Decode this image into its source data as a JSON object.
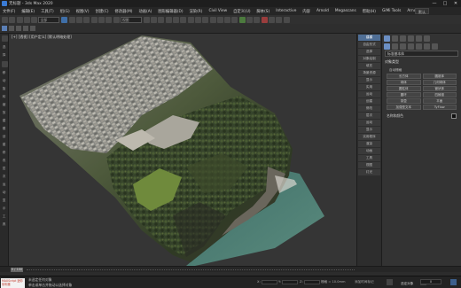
{
  "window": {
    "title": "无标题 - 3ds Max 2020",
    "controls": [
      "—",
      "□",
      "✕"
    ]
  },
  "menu": {
    "items": [
      "文件(F)",
      "编辑(E)",
      "工具(T)",
      "组(G)",
      "视图(V)",
      "创建(C)",
      "修改器(M)",
      "动画(A)",
      "图形编辑器(D)",
      "渲染(R)",
      "Civil View",
      "自定义(U)",
      "脚本(S)",
      "Interactive",
      "内容",
      "Arnold",
      "Megascans",
      "帮助(H)",
      "GiMi Tools",
      "Arnold"
    ],
    "workspace": "默认"
  },
  "toolbar": {
    "selection_filter": "全部",
    "view_select": "视图"
  },
  "viewport": {
    "label": "[+] [透视] [用户定义] [默认明暗处理]"
  },
  "left_toolbar": {
    "labels": [
      "选",
      "择",
      "移",
      "动",
      "旋",
      "转",
      "缩",
      "放",
      "建",
      "模",
      "创",
      "建",
      "修",
      "改",
      "层",
      "次",
      "运",
      "动",
      "显",
      "示",
      "工",
      "具"
    ]
  },
  "command_tabs": [
    "建模",
    "自由形式",
    "选择",
    "对象绘制",
    "填充",
    "场景资源",
    "显示",
    "实用",
    "运动",
    "创建",
    "修改",
    "层次",
    "运动",
    "显示",
    "实用程序",
    "渲染",
    "动画",
    "工具",
    "视图",
    "灯光"
  ],
  "command_panel": {
    "dropdown": "标准基本体",
    "rollout_title": "对象类型",
    "auto_grid": "自动栅格",
    "objects": [
      "长方体",
      "圆锥体",
      "球体",
      "几何球体",
      "圆柱体",
      "管状体",
      "圆环",
      "四棱锥",
      "茶壶",
      "平面",
      "加强型文本",
      "TyFlow"
    ],
    "name_color_title": "名称和颜色"
  },
  "timeline": {
    "thumb": "0 / 100"
  },
  "status": {
    "logo_text": "MAXScript 迷你侦听器",
    "line1": "未选定任何对象",
    "line2": "单击或单击并拖动以选择对象",
    "x_label": "X:",
    "y_label": "Y:",
    "z_label": "Z:",
    "grid": "栅格 = 10.0mm",
    "add_time_tag": "添加时间标记",
    "set_key": "设置关键点",
    "auto_key": "自动关键点",
    "selected": "选定对象",
    "frame": "0"
  }
}
